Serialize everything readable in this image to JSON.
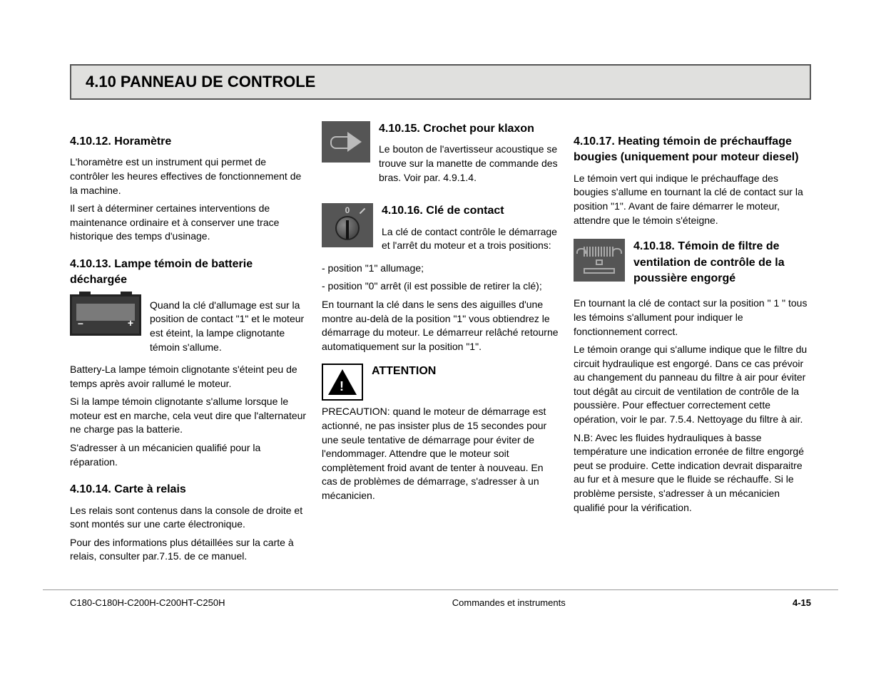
{
  "title": "4.10 PANNEAU DE CONTROLE",
  "col1": {
    "h1": "4.10.12. Horamètre",
    "p1": "L'horamètre est un instrument qui permet de contrôler les heures effectives de fonctionnement de la machine.",
    "p2": "Il sert à déterminer certaines interventions de maintenance ordinaire et à conserver une trace historique des temps d'usinage.",
    "h2": "4.10.13. Lampe témoin de batterie déchargée",
    "p3": "Quand la clé d'allumage est sur la position de contact \"1\" et le moteur est éteint, la lampe clignotante témoin s'allume.",
    "p4": "Battery-La lampe témoin clignotante s'éteint peu de temps après avoir rallumé le moteur.",
    "p5": "Si la lampe témoin clignotante s'allume lorsque le moteur est en marche, cela veut dire que l'alternateur ne charge pas la batterie.",
    "p6": "S'adresser à un mécanicien qualifié pour la réparation.",
    "h3": "4.10.14. Carte à relais",
    "p7": "Les relais sont contenus dans la console de droite et sont montés sur une carte électronique.",
    "p8": "Pour des informations plus détaillées sur la carte à relais, consulter par.7.15. de ce manuel."
  },
  "col2": {
    "h1": "4.10.15. Crochet pour klaxon",
    "p1": "Le bouton de l'avertisseur acoustique se trouve sur la manette de commande des bras. Voir par. 4.9.1.4.",
    "h2": "4.10.16. Clé de contact",
    "p2": "La clé de contact contrôle le démarrage et l'arrêt du moteur et a trois positions:",
    "li1": "- position \"1\" allumage;",
    "li2": "- position \"0\" arrêt (il est possible de retirer la clé);",
    "p3": "En tournant la clé dans le sens des aiguilles d'une montre au-delà de la position \"1\" vous obtiendrez le démarrage du moteur. Le démarreur relâché retourne automatiquement sur la position \"1\".",
    "h3": "ATTENTION",
    "p4": "PRECAUTION: quand le moteur de démarrage est actionné, ne pas insister plus de 15 secondes pour une seule tentative de démarrage pour éviter de l'endommager. Attendre que le moteur soit complètement froid avant de tenter à nouveau. En cas de problèmes de démarrage, s'adresser à un mécanicien."
  },
  "col3": {
    "h1": "4.10.17. Heating témoin de préchauffage bougies (uniquement pour moteur diesel)",
    "p1": "Le témoin vert qui indique le préchauffage des bougies s'allume en tournant la clé de contact sur la position \"1\". Avant de faire démarrer le moteur, attendre que le témoin s'éteigne.",
    "h2": "4.10.18. Témoin de filtre de ventilation de contrôle de la poussière engorgé",
    "p2": "En tournant la clé de contact sur la position \" 1 \" tous les témoins s'allument pour indiquer le fonctionnement correct.",
    "p3": "Le témoin orange qui s'allume indique que le filtre du circuit hydraulique est engorgé. Dans ce cas prévoir au changement du panneau du filtre à air pour éviter tout dégât au circuit de ventilation de contrôle de la poussière. Pour effectuer correctement cette opération, voir le par. 7.5.4. Nettoyage du filtre à air.",
    "p4": "N.B: Avec les fluides hydrauliques à basse température une indication erronée de filtre engorgé peut se produire. Cette indication devrait disparaitre au fur et à mesure que le fluide se réchauffe. Si le problème persiste, s'adresser à un mécanicien qualifié pour la vérification."
  },
  "footer": {
    "left": "C180-C180H-C200H-C200HT-C250H",
    "center": "Commandes et instruments",
    "right": "4-15"
  }
}
